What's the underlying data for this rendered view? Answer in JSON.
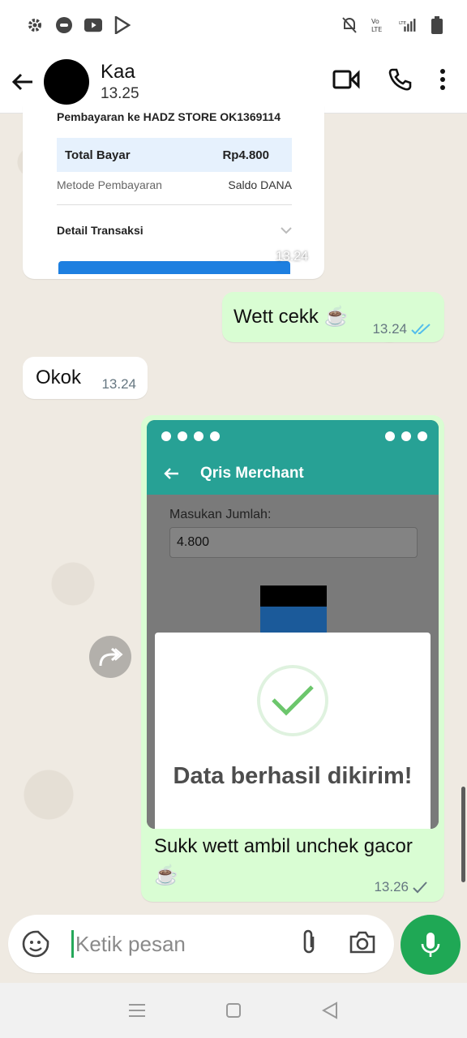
{
  "contact": {
    "name": "Kaa",
    "status": "13.25"
  },
  "messages": {
    "image1": {
      "receipt_header": "Pembayaran ke HADZ STORE OK1369114",
      "total_label": "Total Bayar",
      "total_value": "Rp4.800",
      "method_label": "Metode Pembayaran",
      "method_value": "Saldo DANA",
      "detail_label": "Detail Transaksi",
      "time": "13.24"
    },
    "out1": {
      "text": "Wett cekk ☕",
      "time": "13.24",
      "status": "read"
    },
    "in1": {
      "text": "Okok",
      "time": "13.24"
    },
    "out2": {
      "screenshot": {
        "title": "Qris Merchant",
        "amount_label": "Masukan Jumlah:",
        "amount_value": "4.800",
        "dialog_text": "Data berhasil dikirim!"
      },
      "caption": "Sukk wett ambil unchek gacor ☕",
      "time": "13.26",
      "status": "sent"
    }
  },
  "input": {
    "placeholder": "Ketik pesan"
  },
  "colors": {
    "accent": "#1fa855",
    "outgoing": "#d9fdd3",
    "read_tick": "#53bdeb",
    "teal": "#27a195"
  }
}
